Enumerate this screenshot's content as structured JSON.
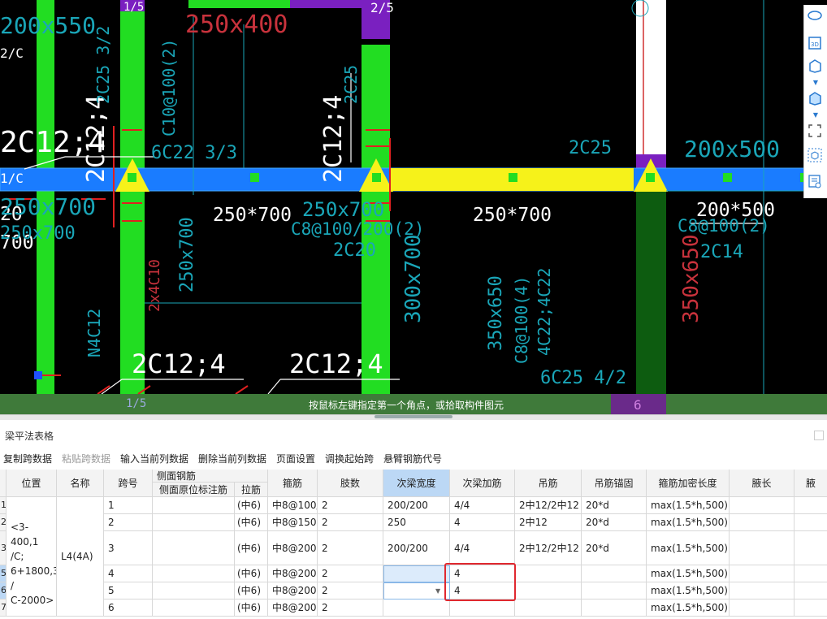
{
  "cad": {
    "labels_white": {
      "beam1": "250*700",
      "beam2": "250*700",
      "beam3": "200*500",
      "rebar_a": "2C12;4",
      "rebar_b": "2C12;4",
      "rebar_c": "2C12;4",
      "rebar_d": "2C12;4",
      "rebar_e": "2C12;4",
      "left_a": "20",
      "left_b": "700",
      "axis_c": "2/C",
      "axis_1c": "1/C",
      "frac_15": "1/5",
      "frac_25": "2/5"
    },
    "labels_red": {
      "size_top": "250x400",
      "col_650": "350x650",
      "side_2x4": "2x4C10",
      "side_n": "N4C12"
    },
    "labels_cyan": {
      "t1": "200x550",
      "t2": "250x700",
      "t3": "250x700",
      "t4": "250x700",
      "t5": "C8@100/200(2)",
      "t6": "C8@100(2)",
      "t7": "2C20",
      "t8": "300x700",
      "t9": "350x650",
      "t10": "C8@100(4)",
      "t11": "4C22;4C22",
      "t12": "6C25 4/2",
      "t13": "2C25",
      "t14": "200x500",
      "t15": "2C14",
      "t16": "6C22 3/3",
      "t17": "C10@100(2)",
      "t18": "2C25 3/2",
      "t19": "250x700",
      "t20": "N4C12",
      "t21": "2C25"
    },
    "status_message": "按鼠标左键指定第一个角点，或拾取构件图元",
    "status_frac": "1/5",
    "status_num": "6"
  },
  "right_tools": [
    "orbit-icon",
    "view-3d-icon",
    "box-icon",
    "box-filled-icon",
    "select-region-icon",
    "component-icon",
    "list-view-icon"
  ],
  "panel": {
    "title": "梁平法表格"
  },
  "toolbar": {
    "copy_span": "复制跨数据",
    "paste_span": "粘贴跨数据",
    "input_col": "输入当前列数据",
    "delete_col": "删除当前列数据",
    "page_setup": "页面设置",
    "swap_start": "调换起始跨",
    "cantilever": "悬臂钢筋代号"
  },
  "table": {
    "headers": {
      "position": "位置",
      "name": "名称",
      "span": "跨号",
      "side_group": "侧面钢筋",
      "side_orig": "侧面原位标注筋",
      "tie": "拉筋",
      "stirrup": "箍筋",
      "legs": "肢数",
      "sec_width": "次梁宽度",
      "sec_add": "次梁加筋",
      "hanger": "吊筋",
      "hanger_anchor": "吊筋锚固",
      "dense_len": "箍筋加密长度",
      "haunch_len": "腋长",
      "haunch_cut": "腋"
    },
    "merged": {
      "position": "<3-400,1/C;6+1800,3/C-2000>",
      "position_lines": [
        "<3-400,1",
        "/C;",
        "6+1800,3",
        "/",
        "C-2000>"
      ],
      "name": "L4(4A)"
    },
    "rownums": [
      "1",
      "2",
      "3",
      "4",
      "5",
      "6",
      "7"
    ],
    "rows": [
      {
        "span": "1",
        "tie": "(中6)",
        "stirrup": "中8@100/",
        "legs": "2",
        "sec_width": "200/200",
        "sec_add": "4/4",
        "hanger": "2中12/2中12",
        "anchor": "20*d",
        "dense": "max(1.5*h,500)"
      },
      {
        "span": "2",
        "tie": "(中6)",
        "stirrup": "中8@150(",
        "legs": "2",
        "sec_width": "250",
        "sec_add": "4",
        "hanger": "2中12",
        "anchor": "20*d",
        "dense": "max(1.5*h,500)"
      },
      {
        "span": "3",
        "tie": "(中6)",
        "stirrup": "中8@200(",
        "legs": "2",
        "sec_width": "200/200",
        "sec_add": "4/4",
        "hanger": "2中12/2中12",
        "anchor": "20*d",
        "dense": "max(1.5*h,500)"
      },
      {
        "span": "4",
        "tie": "(中6)",
        "stirrup": "中8@200(",
        "legs": "2",
        "sec_width": "",
        "sec_add": "4",
        "hanger": "",
        "anchor": "",
        "dense": "max(1.5*h,500)"
      },
      {
        "span": "5",
        "tie": "(中6)",
        "stirrup": "中8@200(",
        "legs": "2",
        "sec_width": "",
        "sec_add": "4",
        "hanger": "",
        "anchor": "",
        "dense": "max(1.5*h,500)"
      },
      {
        "span": "6",
        "tie": "(中6)",
        "stirrup": "中8@200(",
        "legs": "2",
        "sec_width": "",
        "sec_add": "",
        "hanger": "",
        "anchor": "",
        "dense": "max(1.5*h,500)"
      }
    ]
  }
}
